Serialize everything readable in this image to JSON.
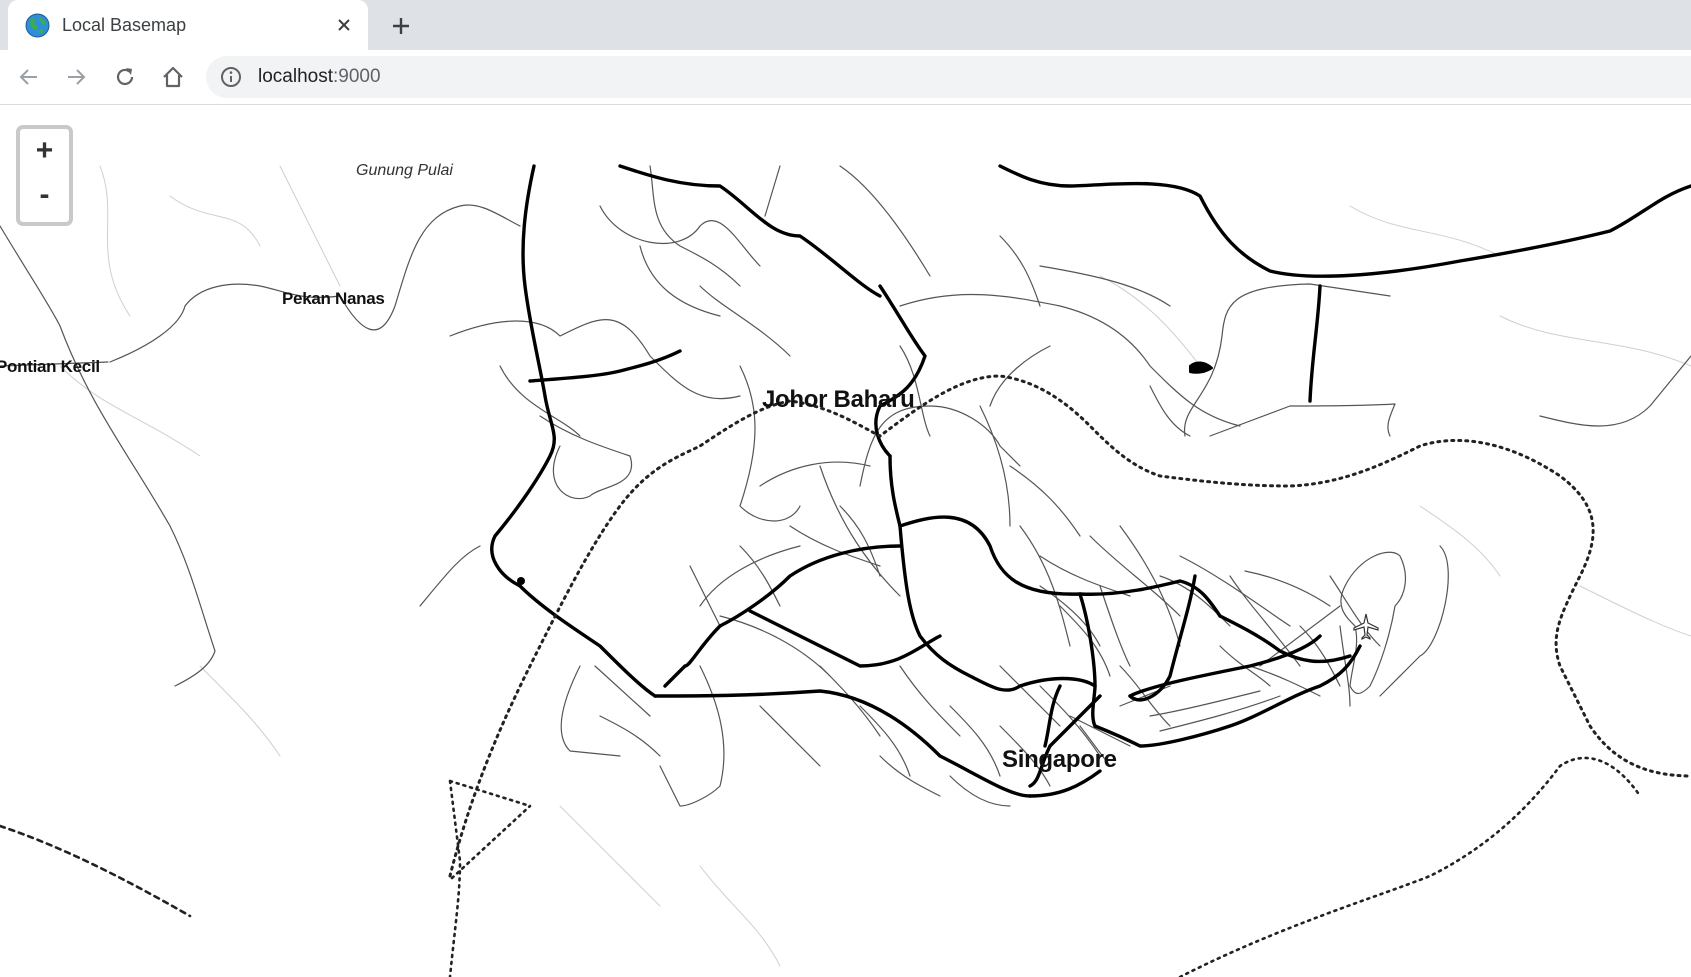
{
  "tab": {
    "title": "Local Basemap",
    "favicon": "globe-icon",
    "close": "✕",
    "new_tab": "+"
  },
  "toolbar": {
    "back": "arrow-left-icon",
    "forward": "arrow-right-icon",
    "reload": "reload-icon",
    "home": "home-icon",
    "url_host": "localhost",
    "url_port": ":9000"
  },
  "map": {
    "zoom_in": "+",
    "zoom_out": "-",
    "labels": {
      "gunung_pulai": "Gunung Pulai",
      "pekan_nanas": "Pekan Nanas",
      "pontian_kecil": "Pontian Kecil",
      "johor_baharu": "Johor Baharu",
      "singapore": "Singapore"
    },
    "airport": "airplane-icon"
  },
  "colors": {
    "tabbar": "#dee1e6",
    "omnibox": "#f1f3f4",
    "road": "#000000"
  }
}
